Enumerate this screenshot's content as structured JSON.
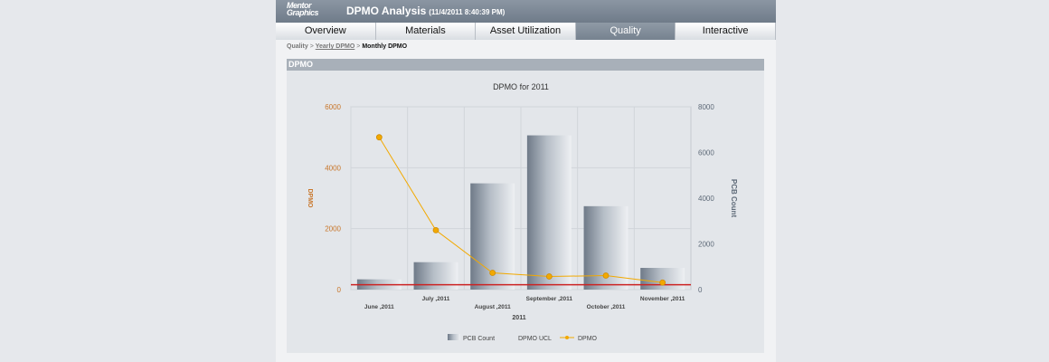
{
  "header": {
    "logo_line1": "Mentor",
    "logo_line2": "Graphics",
    "title": "DPMO Analysis",
    "timestamp": "(11/4/2011 8:40:39 PM)"
  },
  "tabs": [
    {
      "label": "Overview",
      "active": false
    },
    {
      "label": "Materials",
      "active": false
    },
    {
      "label": "Asset Utilization",
      "active": false
    },
    {
      "label": "Quality",
      "active": true
    },
    {
      "label": "Interactive",
      "active": false
    }
  ],
  "breadcrumb": {
    "root": "Quality",
    "link": "Yearly DPMO",
    "current": "Monthly DPMO",
    "separator": ">"
  },
  "section": {
    "title": "DPMO"
  },
  "chart_data": {
    "type": "bar",
    "title": "DPMO for  2011",
    "xlabel": "2011",
    "ylabel": "DPMO",
    "y2label": "PCB Count",
    "categories": [
      "June ,2011",
      "July ,2011",
      "August ,2011",
      "September ,2011",
      "October ,2011",
      "November ,2011"
    ],
    "ylim": [
      0,
      6000
    ],
    "y2lim": [
      0,
      8000
    ],
    "yticks": [
      0,
      2000,
      4000,
      6000
    ],
    "y2ticks": [
      0,
      2000,
      4000,
      6000,
      8000
    ],
    "series": [
      {
        "name": "PCB Count",
        "kind": "bar",
        "axis": "right",
        "values": [
          450,
          1200,
          4650,
          6750,
          3650,
          950
        ]
      },
      {
        "name": "DPMO UCL",
        "kind": "hline",
        "axis": "left",
        "values": [
          160,
          160,
          160,
          160,
          160,
          160
        ]
      },
      {
        "name": "DPMO",
        "kind": "line",
        "axis": "left",
        "values": [
          5000,
          1950,
          550,
          430,
          460,
          230
        ]
      }
    ],
    "legend_position": "bottom",
    "colors": {
      "bar": "#8d97a3",
      "ucl": "#cc2222",
      "line": "#f2a900",
      "left_axis": "#c8762a",
      "right_axis": "#5e6a78"
    }
  }
}
